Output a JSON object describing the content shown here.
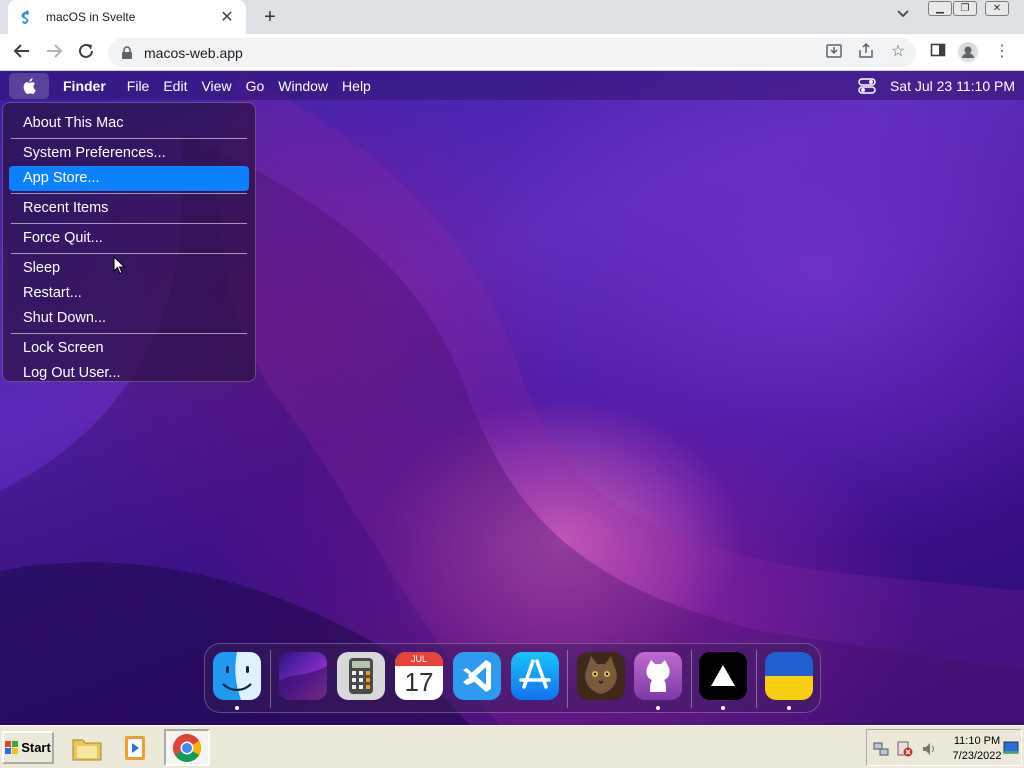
{
  "browser": {
    "tab_title": "macOS in Svelte",
    "url": "macos-web.app"
  },
  "menubar": {
    "app_name": "Finder",
    "items": [
      "File",
      "Edit",
      "View",
      "Go",
      "Window",
      "Help"
    ],
    "clock": "Sat Jul 23  11:10 PM"
  },
  "apple_menu": {
    "items": [
      "About This Mac",
      "System Preferences...",
      "App Store...",
      "Recent Items",
      "Force Quit...",
      "Sleep",
      "Restart...",
      "Shut Down...",
      "Lock Screen",
      "Log Out User..."
    ],
    "highlighted": "App Store..."
  },
  "dock": {
    "apps": [
      "finder",
      "wallpapers",
      "calculator",
      "calendar",
      "vscode",
      "app-store",
      "purrr",
      "github",
      "vercel",
      "ukraine"
    ],
    "calendar_month": "JUL",
    "calendar_day": "17"
  },
  "taskbar": {
    "start_label": "Start",
    "time": "11:10 PM",
    "date": "7/23/2022"
  },
  "colors": {
    "menu_highlight": "#0a82ff",
    "desktop_purple": "#4a1fa8"
  }
}
